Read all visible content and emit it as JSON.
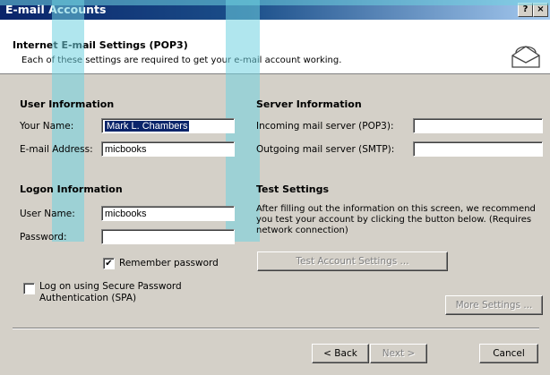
{
  "window": {
    "title": "E-mail Accounts",
    "help_button": "?",
    "close_button": "×"
  },
  "header": {
    "title": "Internet E-mail Settings (POP3)",
    "subtitle": "Each of these settings are required to get your e-mail account working."
  },
  "user_info": {
    "heading": "User Information",
    "name_label": "Your Name:",
    "name_value": "Mark L. Chambers",
    "email_label": "E-mail Address:",
    "email_value": "micbooks"
  },
  "server_info": {
    "heading": "Server Information",
    "incoming_label": "Incoming mail server (POP3):",
    "incoming_value": "",
    "outgoing_label": "Outgoing mail server (SMTP):",
    "outgoing_value": ""
  },
  "logon_info": {
    "heading": "Logon Information",
    "username_label": "User Name:",
    "username_value": "micbooks",
    "password_label": "Password:",
    "password_value": "",
    "remember_label": "Remember password",
    "remember_checked": true,
    "spa_label_line1": "Log on using Secure Password",
    "spa_label_line2": "Authentication (SPA)",
    "spa_checked": false
  },
  "test_settings": {
    "heading": "Test Settings",
    "description": "After filling out the information on this screen, we recommend you test your account by clicking the button below. (Requires network connection)",
    "test_button": "Test Account Settings ...",
    "more_settings_button": "More Settings ..."
  },
  "footer": {
    "back_button": "< Back",
    "next_button": "Next >",
    "cancel_button": "Cancel"
  },
  "colors": {
    "title_bar": "#0a246a",
    "dialog_face": "#d4d0c8",
    "banner_overlay": "#6fd1e0"
  }
}
